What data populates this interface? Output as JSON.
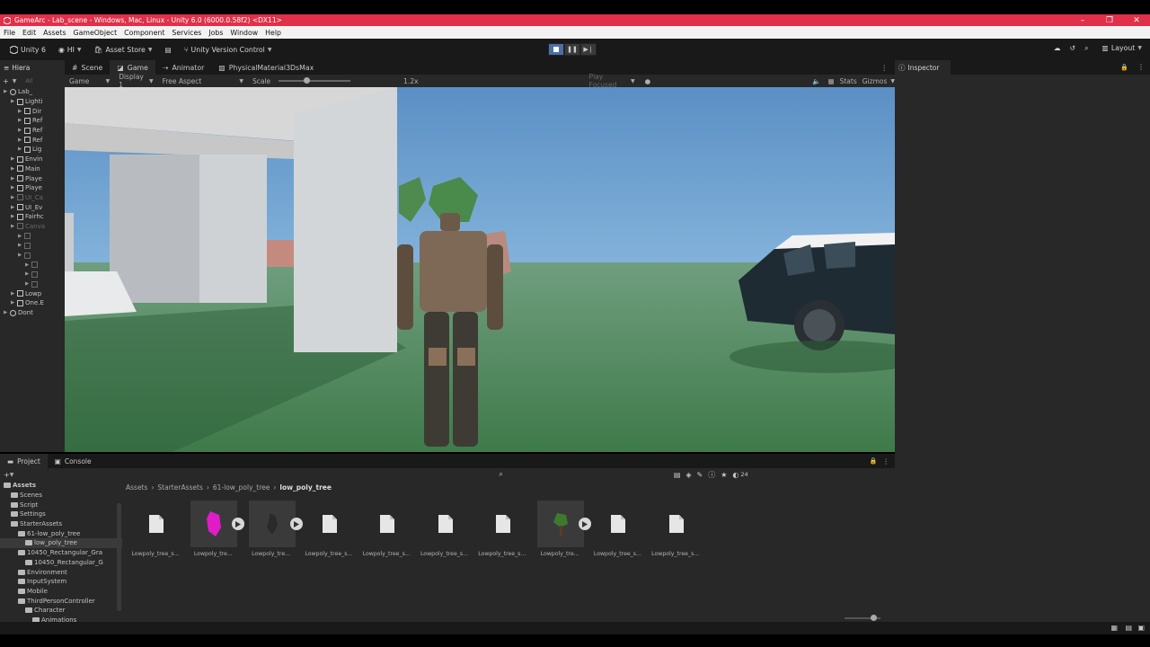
{
  "window": {
    "title": "GameArc - Lab_scene - Windows, Mac, Linux - Unity 6.0 (6000.0.58f2) <DX11>",
    "controls": [
      "–",
      "❐",
      "✕"
    ]
  },
  "menu": [
    "File",
    "Edit",
    "Assets",
    "GameObject",
    "Component",
    "Services",
    "Jobs",
    "Window",
    "Help"
  ],
  "toolbar": {
    "unity_label": "Unity 6",
    "account_label": "HI",
    "asset_store_label": "Asset Store",
    "version_control_label": "Unity Version Control",
    "layout_label": "Layout"
  },
  "hierarchy": {
    "tab_label": "Hiera",
    "search_placeholder": "All",
    "rows": [
      {
        "label": "Lab_",
        "indent": 0,
        "type": "scene",
        "dim": false
      },
      {
        "label": "Lighti",
        "indent": 1,
        "type": "obj",
        "dim": false
      },
      {
        "label": "Dir",
        "indent": 2,
        "type": "obj",
        "dim": false
      },
      {
        "label": "Ref",
        "indent": 2,
        "type": "obj",
        "dim": false
      },
      {
        "label": "Ref",
        "indent": 2,
        "type": "obj",
        "dim": false
      },
      {
        "label": "Ref",
        "indent": 2,
        "type": "obj",
        "dim": false
      },
      {
        "label": "Lig",
        "indent": 2,
        "type": "obj",
        "dim": false
      },
      {
        "label": "Envin",
        "indent": 1,
        "type": "obj",
        "dim": false
      },
      {
        "label": "Main",
        "indent": 1,
        "type": "obj",
        "dim": false
      },
      {
        "label": "Playe",
        "indent": 1,
        "type": "obj",
        "dim": false
      },
      {
        "label": "Playe",
        "indent": 1,
        "type": "obj",
        "dim": false
      },
      {
        "label": "UI_Ca",
        "indent": 1,
        "type": "obj",
        "dim": true
      },
      {
        "label": "UI_Ev",
        "indent": 1,
        "type": "obj",
        "dim": false
      },
      {
        "label": "Fairhc",
        "indent": 1,
        "type": "obj",
        "dim": false
      },
      {
        "label": "Canva",
        "indent": 1,
        "type": "obj",
        "dim": true
      },
      {
        "label": "",
        "indent": 2,
        "type": "obj",
        "dim": true
      },
      {
        "label": "",
        "indent": 2,
        "type": "obj",
        "dim": true
      },
      {
        "label": "",
        "indent": 2,
        "type": "obj",
        "dim": true
      },
      {
        "label": "",
        "indent": 3,
        "type": "obj",
        "dim": true
      },
      {
        "label": "",
        "indent": 3,
        "type": "obj",
        "dim": true
      },
      {
        "label": "",
        "indent": 3,
        "type": "obj",
        "dim": true
      },
      {
        "label": "Lowp",
        "indent": 1,
        "type": "obj",
        "dim": false
      },
      {
        "label": "One.E",
        "indent": 1,
        "type": "obj",
        "dim": false
      },
      {
        "label": "Dont",
        "indent": 0,
        "type": "scene",
        "dim": false
      }
    ]
  },
  "view_tabs": [
    {
      "label": "Scene",
      "icon": "scene-icon",
      "active": false
    },
    {
      "label": "Game",
      "icon": "game-icon",
      "active": true
    },
    {
      "label": "Animator",
      "icon": "animator-icon",
      "active": false
    },
    {
      "label": "PhysicalMaterial3DsMax",
      "icon": "material-icon",
      "active": false
    }
  ],
  "game_toolbar": {
    "mode": "Game",
    "display": "Display 1",
    "aspect": "Free Aspect",
    "scale_label": "Scale",
    "scale_value": "1.2x",
    "play_focused": "Play Focused",
    "stats": "Stats",
    "gizmos": "Gizmos"
  },
  "inspector": {
    "tab_label": "Inspector"
  },
  "project": {
    "tabs": [
      {
        "label": "Project",
        "active": true
      },
      {
        "label": "Console",
        "active": false
      }
    ],
    "item_count": "24",
    "tree": [
      {
        "label": "Assets",
        "indent": 0,
        "bold": true,
        "selected": false
      },
      {
        "label": "Scenes",
        "indent": 1,
        "bold": false,
        "selected": false
      },
      {
        "label": "Script",
        "indent": 1,
        "bold": false,
        "selected": false
      },
      {
        "label": "Settings",
        "indent": 1,
        "bold": false,
        "selected": false
      },
      {
        "label": "StarterAssets",
        "indent": 1,
        "bold": false,
        "selected": false
      },
      {
        "label": "61-low_poly_tree",
        "indent": 2,
        "bold": false,
        "selected": false
      },
      {
        "label": "low_poly_tree",
        "indent": 3,
        "bold": false,
        "selected": true
      },
      {
        "label": "10450_Rectangular_Gra",
        "indent": 2,
        "bold": false,
        "selected": false
      },
      {
        "label": "10450_Rectangular_G",
        "indent": 3,
        "bold": false,
        "selected": false
      },
      {
        "label": "Environment",
        "indent": 2,
        "bold": false,
        "selected": false
      },
      {
        "label": "InputSystem",
        "indent": 2,
        "bold": false,
        "selected": false
      },
      {
        "label": "Mobile",
        "indent": 2,
        "bold": false,
        "selected": false
      },
      {
        "label": "ThirdPersonController",
        "indent": 2,
        "bold": false,
        "selected": false
      },
      {
        "label": "Character",
        "indent": 3,
        "bold": false,
        "selected": false
      },
      {
        "label": "Animations",
        "indent": 4,
        "bold": false,
        "selected": false
      }
    ],
    "breadcrumb": [
      "Assets",
      "StarterAssets",
      "61-low_poly_tree",
      "low_poly_tree"
    ],
    "assets": [
      {
        "label": "Lowpoly_tree_s...",
        "kind": "file",
        "play": false
      },
      {
        "label": "Lowpoly_tre...",
        "kind": "magenta",
        "play": true
      },
      {
        "label": "Lowpoly_tre...",
        "kind": "dark-model",
        "play": true
      },
      {
        "label": "Lowpoly_tree_s...",
        "kind": "file",
        "play": false
      },
      {
        "label": "Lowpoly_tree_s...",
        "kind": "file",
        "play": false
      },
      {
        "label": "Lowpoly_tree_s...",
        "kind": "file",
        "play": false
      },
      {
        "label": "Lowpoly_tree_s...",
        "kind": "file",
        "play": false
      },
      {
        "label": "Lowpoly_tre...",
        "kind": "green-tree",
        "play": true
      },
      {
        "label": "Lowpoly_tree_s...",
        "kind": "file",
        "play": false
      },
      {
        "label": "Lowpoly_tree_s...",
        "kind": "file",
        "play": false
      }
    ]
  },
  "colors": {
    "title_bar": "#e0304a",
    "play_active": "#4b6fa6",
    "panel": "#282828",
    "dark": "#191919"
  }
}
